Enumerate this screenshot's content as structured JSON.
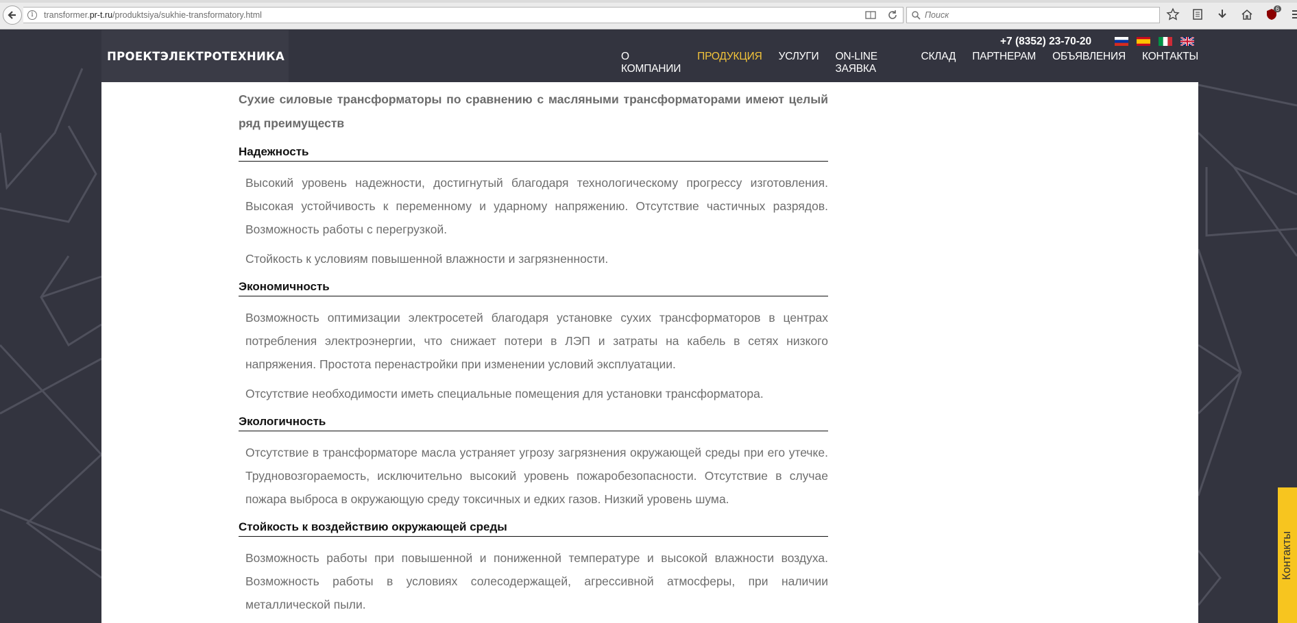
{
  "browser": {
    "url_prefix": "transformer.",
    "url_host": "pr-t.ru",
    "url_path": "/produktsiya/sukhie-transformatory.html",
    "search_placeholder": "Поиск",
    "badge_count": "6"
  },
  "header": {
    "logo": "ПРОЕКТЭЛЕКТРОТЕХНИКА",
    "phone": "+7 (8352) 23-70-20",
    "nav": [
      {
        "label": "О КОМПАНИИ"
      },
      {
        "label": "ПРОДУКЦИЯ"
      },
      {
        "label": "УСЛУГИ"
      },
      {
        "label": "ON-LINE ЗАЯВКА"
      },
      {
        "label": "СКЛАД"
      },
      {
        "label": "ПАРТНЕРАМ"
      },
      {
        "label": "ОБЪЯВЛЕНИЯ"
      },
      {
        "label": "КОНТАКТЫ"
      }
    ],
    "active_nav_color": "#f3c43a"
  },
  "article": {
    "intro": "Сухие силовые трансформаторы по сравнению с масляными трансформаторами имеют целый ряд преимуществ",
    "sections": [
      {
        "title": "Надежность",
        "paragraphs": [
          "Высокий уровень надежности, достигнутый благодаря технологическому прогрессу изготовления. Высокая устойчивость к переменному и ударному напряжению. Отсутствие частичных разрядов. Возможность работы с перегрузкой.",
          "Стойкость к условиям повышенной влажности и загрязненности."
        ]
      },
      {
        "title": "Экономичность",
        "paragraphs": [
          "Возможность оптимизации электросетей благодаря установке сухих трансформаторов в центрах потребления электроэнергии, что снижает потери в ЛЭП и затраты на кабель в сетях низкого напряжения. Простота перенастройки при изменении условий эксплуатации.",
          "Отсутствие необходимости иметь специальные помещения для установки трансформатора."
        ]
      },
      {
        "title": "Экологичность",
        "paragraphs": [
          "Отсутствие в трансформаторе масла устраняет угрозу загрязнения окружающей среды при его утечке. Трудновозгораемость, исключительно высокий уровень пожаробезопасности. Отсутствие в случае пожара выброса в окружающую среду токсичных и едких газов. Низкий уровень шума."
        ]
      },
      {
        "title": "Стойкость к воздействию окружающей среды",
        "paragraphs": [
          "Возможность работы при повышенной и пониженной температуре и высокой влажности воздуха. Возможность работы в условиях солесодержащей, агрессивной атмосферы, при наличии металлической пыли."
        ]
      }
    ]
  },
  "contacts_tab": "Контакты",
  "colors": {
    "page_bg": "#33343f",
    "accent_yellow": "#f7c51f"
  }
}
